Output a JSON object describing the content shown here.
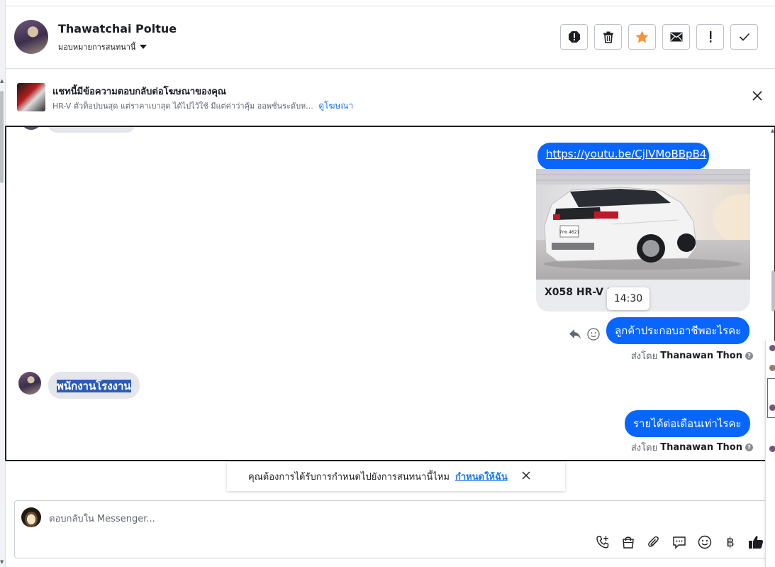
{
  "header": {
    "contact_name": "Thawatchai Poltue",
    "assign_label": "มอบหมายการสนทนานี้",
    "actions": [
      {
        "name": "report-spam-button",
        "icon": "alert-octagon-icon"
      },
      {
        "name": "delete-button",
        "icon": "trash-icon"
      },
      {
        "name": "star-button",
        "icon": "star-icon"
      },
      {
        "name": "mark-unread-button",
        "icon": "envelope-icon"
      },
      {
        "name": "follow-up-button",
        "icon": "exclamation-icon"
      },
      {
        "name": "mark-done-button",
        "icon": "check-icon"
      }
    ],
    "star_color": "#f7923b"
  },
  "ad_banner": {
    "title": "แชทนี้มีข้อความตอบกลับต่อโฆษณาของคุณ",
    "description": "HR-V ตัวท็อปบนสุด แต่ราคาเบาสุด ได้ไปไว้ใช้ มีแต่ค่าว่าคุ้ม ออพชั่นระดับห...",
    "view_ad_link": "ดูโฆษณา"
  },
  "messages": {
    "link_url": "https://youtu.be/CjlVMoBBpB4",
    "card_title": "X058 HR-V 1.",
    "tooltip_time": "14:30",
    "outgoing_1": "ลูกค้าประกอบอาชีพอะไรคะ",
    "sent_by_label": "ส่งโดย",
    "sent_by_name": "Thanawan Thon",
    "incoming_1": "พนักงานโรงงาน",
    "outgoing_2": "รายได้ต่อเดือนเท่าไรคะ",
    "help_glyph": "?"
  },
  "toast": {
    "question": "คุณต้องการได้รับการกำหนดไปยังการสนทนานี้ไหม",
    "action_link": "กำหนดให้ฉัน"
  },
  "composer": {
    "placeholder": "ตอบกลับใน Messenger...",
    "tools": [
      "call-add-icon",
      "shopping-bag-icon",
      "paperclip-icon",
      "saved-reply-icon",
      "emoji-icon",
      "baht-icon",
      "thumbs-up-icon"
    ],
    "baht_glyph": "฿"
  },
  "colors": {
    "outgoing_bubble": "#0866ff",
    "incoming_bubble": "#e4e6eb",
    "link": "#1876f2"
  }
}
